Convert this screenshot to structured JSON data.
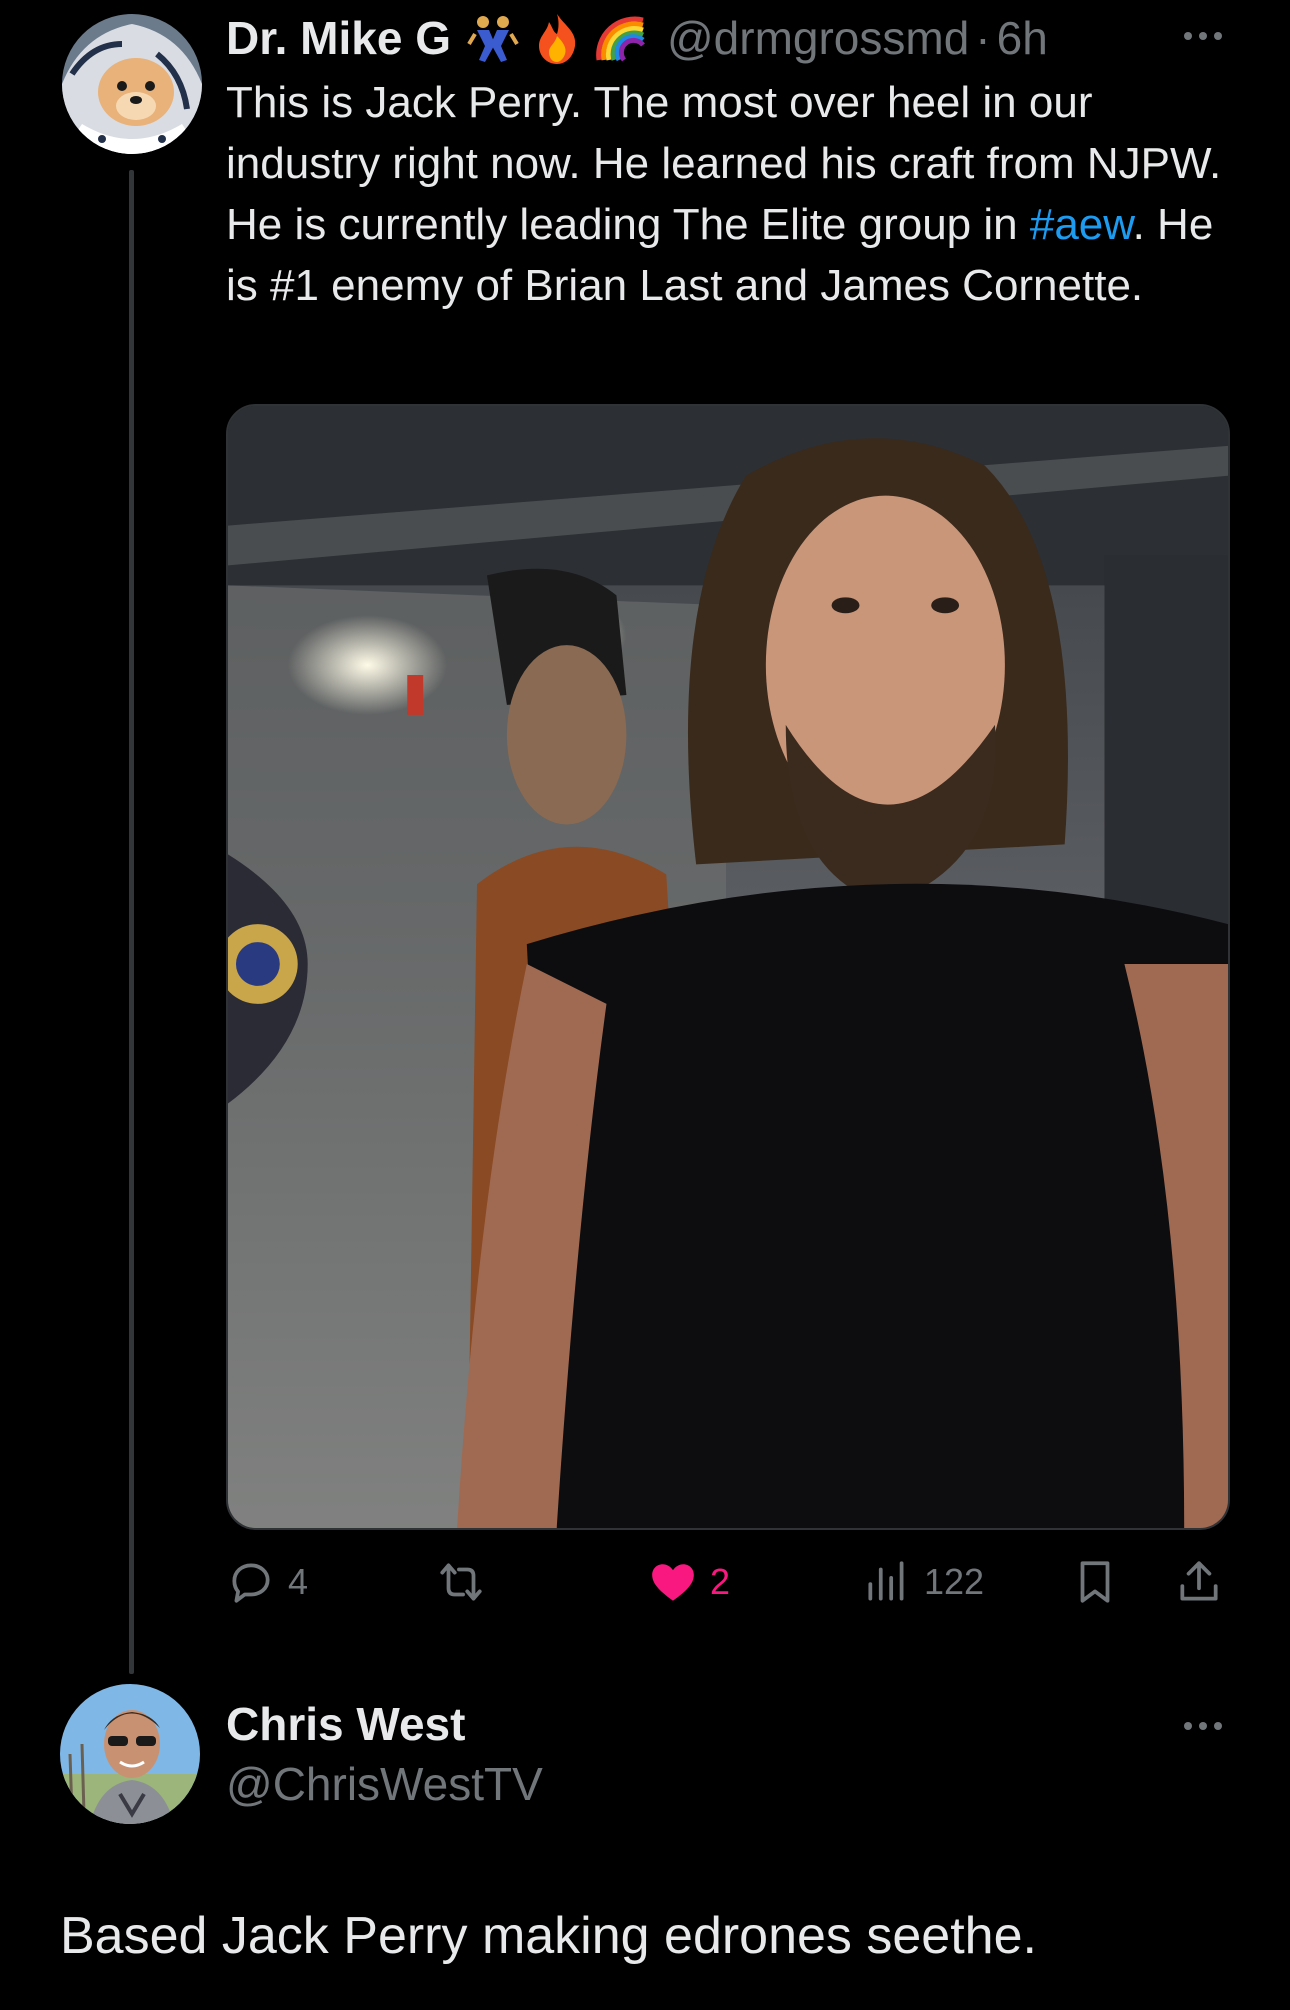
{
  "tweet": {
    "author": {
      "display_name": "Dr. Mike G",
      "handle": "@drmgrossmd",
      "separator": "·",
      "time": "6h",
      "emojis": [
        "wrestlers-emoji",
        "fire-emoji",
        "rainbow-emoji"
      ]
    },
    "text": {
      "part1": "This is Jack Perry. The most over heel in our industry right now. He learned his craft from NJPW. He is currently leading The Elite group in ",
      "hashtag": "#aew",
      "part2": ". He is #1 enemy of Brian Last and James Cornette."
    },
    "media_icon": "photo",
    "actions": {
      "reply_count": "4",
      "retweet_count": "",
      "like_count": "2",
      "view_count": "122",
      "liked": true
    }
  },
  "reply": {
    "author": {
      "display_name": "Chris West",
      "handle": "@ChrisWestTV"
    },
    "text": "Based Jack Perry making edrones seethe."
  },
  "colors": {
    "background": "#000000",
    "text_primary": "#e7e9ea",
    "text_secondary": "#71767b",
    "link": "#1d9bf0",
    "like": "#f91880",
    "thread_line": "#333639"
  }
}
